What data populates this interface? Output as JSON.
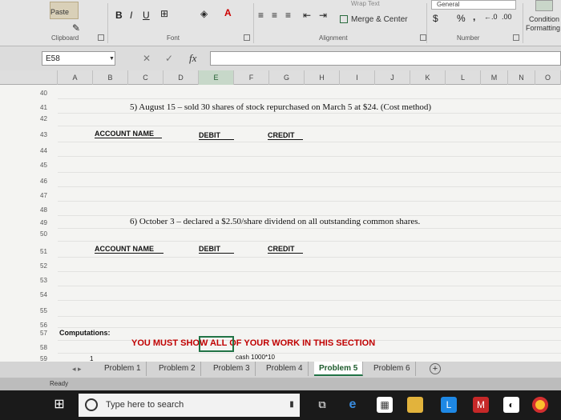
{
  "ribbon": {
    "paste_label": "Paste",
    "clipboard_label": "Clipboard",
    "font_label": "Font",
    "alignment_label": "Alignment",
    "number_label": "Number",
    "bold": "B",
    "italic": "I",
    "underline": "U",
    "merge_center": "Merge & Center",
    "number_format": "General",
    "currency": "$",
    "percent": "%",
    "comma": ",",
    "conditional_line1": "Condition",
    "conditional_line2": "Formatting",
    "wrap_text": "Wrap Text"
  },
  "formula_bar": {
    "name_box": "E58",
    "fx": "fx",
    "cancel": "✕",
    "confirm": "✓"
  },
  "columns": [
    "A",
    "B",
    "C",
    "D",
    "E",
    "F",
    "G",
    "H",
    "I",
    "J",
    "K",
    "L",
    "M",
    "N",
    "O"
  ],
  "selected_column": "E",
  "rows": [
    "40",
    "41",
    "42",
    "43",
    "44",
    "45",
    "46",
    "47",
    "48",
    "49",
    "50",
    "51",
    "52",
    "53",
    "54",
    "55",
    "56",
    "57",
    "58",
    "59"
  ],
  "sheet": {
    "item5": "5) August 15 – sold 30 shares of stock repurchased on March 5 at $24. (Cost method)",
    "item6": "6) October 3 – declared a $2.50/share dividend on all outstanding common shares.",
    "account_name": "ACCOUNT NAME",
    "debit": "DEBIT",
    "credit": "CREDIT",
    "computations": "Computations:",
    "show_work": "YOU MUST SHOW ALL OF YOUR WORK IN THIS SECTION",
    "row59_a": "1",
    "row59_note": "cash 1000*10"
  },
  "tabs": [
    "Problem 1",
    "Problem 2",
    "Problem 3",
    "Problem 4",
    "Problem 5",
    "Problem 6"
  ],
  "active_tab": "Problem 5",
  "status": {
    "ready": "Ready"
  },
  "taskbar": {
    "search_placeholder": "Type here to search"
  }
}
